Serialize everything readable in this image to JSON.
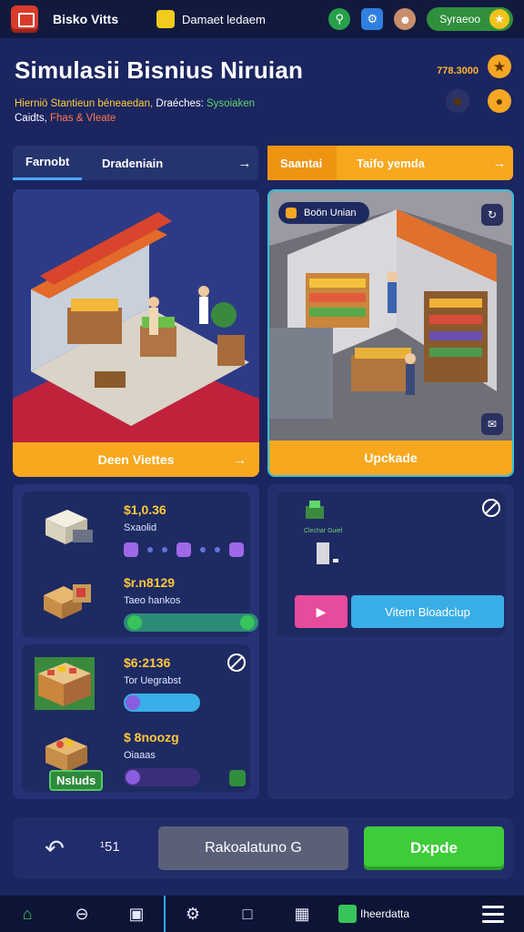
{
  "header": {
    "app_name": "Bisko Vitts",
    "search_chip": "Damaet ledaem",
    "coins": "Syraeoo",
    "colors": {
      "bar": "#111a3e",
      "coin": "#2f8f3c"
    }
  },
  "hero": {
    "title": "Simulasii Bisnius Niruian",
    "subtitle": {
      "part1": "Hierniö Stantieun béneaedan,",
      "part2": "Draéches:",
      "part3": "Sysoiaken",
      "part4": "Caidts,",
      "part5": "Fhas & Vleate"
    },
    "score": "778.3000"
  },
  "tabs": {
    "left": {
      "active": "Farnobt",
      "other": "Dradeniain",
      "arrow": "→"
    },
    "right": {
      "active": "Saantai",
      "other": "Taifo yemda",
      "arrow": "→"
    }
  },
  "cards": {
    "left": {
      "button": "Deen Viettes",
      "arrow": "→"
    },
    "right": {
      "tag": "Boön Unian",
      "button": "Upckade"
    }
  },
  "items": [
    {
      "price": "$1,0.36",
      "name": "Sxaolid",
      "thumb": "box-icon"
    },
    {
      "price": "$r.n8129",
      "name": "Taeo hankos",
      "thumb": "crates-icon"
    },
    {
      "price": "$6:2136",
      "name": "Tor Uegrabst",
      "thumb": "produce-crate-icon"
    },
    {
      "price": "$ 8noozg",
      "name": "Oiaaas",
      "badge": "NsIuds",
      "thumb": "fruit-crate-icon"
    }
  ],
  "right_panel": {
    "mini_label": "Clechar Guiel",
    "video_button": "Vitem Bloadclup"
  },
  "actions": {
    "back_count": "¹51",
    "reset": "Rakoalatuno G",
    "upgrade": "Dxpde"
  },
  "bottom_nav": {
    "store_label": "Iheerdatta"
  }
}
